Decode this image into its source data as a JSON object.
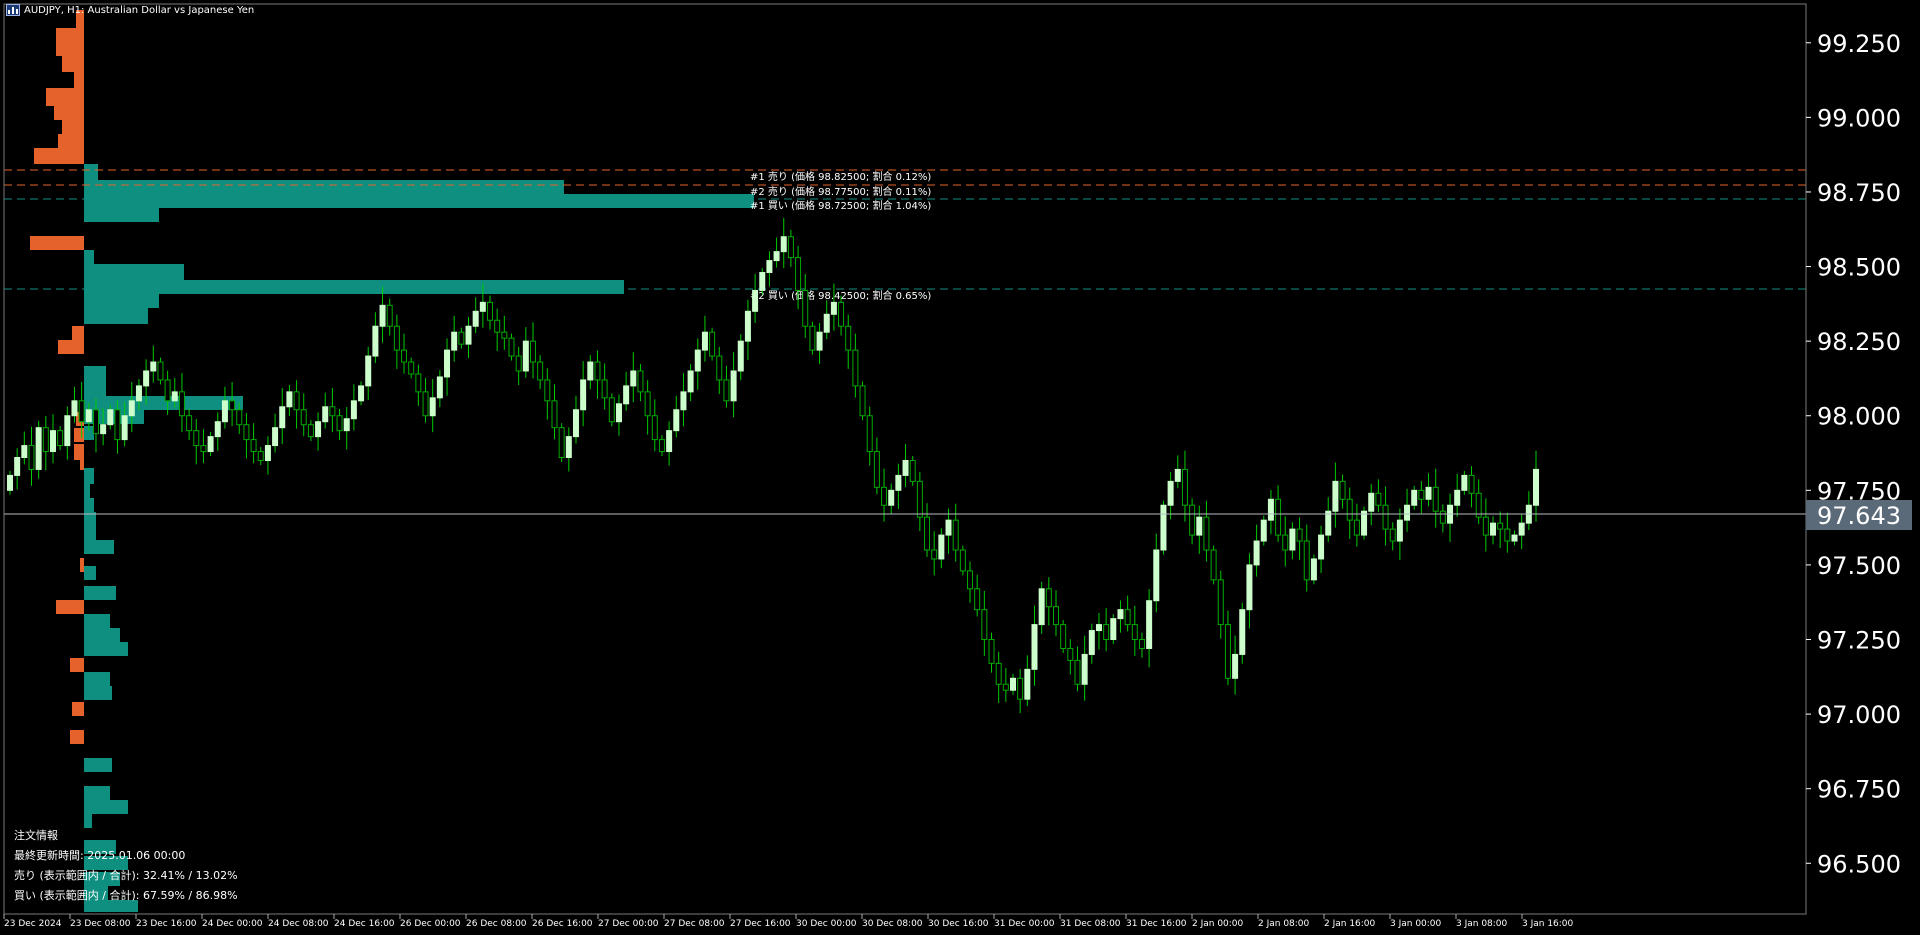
{
  "header": {
    "symbol_title": "AUDJPY, H1:  Australian Dollar vs Japanese Yen",
    "icon": "chart-window-icon"
  },
  "price_axis": {
    "labels": [
      "99.250",
      "99.000",
      "98.750",
      "98.500",
      "98.250",
      "98.000",
      "97.750",
      "97.500",
      "97.250",
      "97.000",
      "96.750",
      "96.500"
    ],
    "current_price": "97.643"
  },
  "time_axis": {
    "labels": [
      "23 Dec 2024",
      "23 Dec 08:00",
      "23 Dec 16:00",
      "24 Dec 00:00",
      "24 Dec 08:00",
      "24 Dec 16:00",
      "26 Dec 00:00",
      "26 Dec 08:00",
      "26 Dec 16:00",
      "27 Dec 00:00",
      "27 Dec 08:00",
      "27 Dec 16:00",
      "30 Dec 00:00",
      "30 Dec 08:00",
      "30 Dec 16:00",
      "31 Dec 00:00",
      "31 Dec 08:00",
      "31 Dec 16:00",
      "2 Jan 00:00",
      "2 Jan 08:00",
      "2 Jan 16:00",
      "3 Jan 00:00",
      "3 Jan 08:00",
      "3 Jan 16:00"
    ]
  },
  "level_labels": [
    {
      "text": "#1 売り (価格 98.82500; 割合 0.12%)",
      "price": 98.825,
      "side": "sell"
    },
    {
      "text": "#2 売り (価格 98.77500; 割合 0.11%)",
      "price": 98.775,
      "side": "sell"
    },
    {
      "text": "#1 買い (価格 98.72500; 割合 1.04%)",
      "price": 98.725,
      "side": "buy"
    },
    {
      "text": "#2 買い (価格 98.42500; 割合 0.65%)",
      "price": 98.425,
      "side": "buy"
    }
  ],
  "order_info": {
    "title": "注文情報",
    "last_update": "最終更新時間: 2025.01.06 00:00",
    "sell_ratio": "売り (表示範囲内 / 合計): 32.41% / 13.02%",
    "buy_ratio": "買い (表示範囲内 / 合計): 67.59% / 86.98%"
  },
  "colors": {
    "background": "#000000",
    "bull_candle": "#ccffcc",
    "bear_candle": "#00aa00",
    "wick": "#00cc00",
    "sell_bar": "#e5632b",
    "buy_bar": "#0f8f80",
    "current_price_badge": "#5b6a78",
    "axis_text": "#ffffff"
  },
  "chart_data": {
    "type": "candlestick",
    "symbol": "AUDJPY",
    "timeframe": "H1",
    "ylim": [
      96.33,
      99.38
    ],
    "current_price": 97.643,
    "closes": [
      97.8,
      97.86,
      97.9,
      97.82,
      97.96,
      97.88,
      97.95,
      97.9,
      98.0,
      98.05,
      97.98,
      98.02,
      97.94,
      97.97,
      98.02,
      97.92,
      98.0,
      98.05,
      98.1,
      98.15,
      98.18,
      98.12,
      98.05,
      98.08,
      98.0,
      97.95,
      97.9,
      97.88,
      97.93,
      97.98,
      98.05,
      98.02,
      97.97,
      97.92,
      97.88,
      97.85,
      97.9,
      97.96,
      98.03,
      98.08,
      98.02,
      97.97,
      97.93,
      97.98,
      98.03,
      98.0,
      97.95,
      97.99,
      98.05,
      98.1,
      98.2,
      98.3,
      98.37,
      98.3,
      98.22,
      98.18,
      98.14,
      98.08,
      98.0,
      98.06,
      98.13,
      98.22,
      98.28,
      98.24,
      98.3,
      98.35,
      98.38,
      98.32,
      98.28,
      98.26,
      98.2,
      98.15,
      98.25,
      98.18,
      98.12,
      98.05,
      97.96,
      97.86,
      97.93,
      98.02,
      98.12,
      98.18,
      98.12,
      98.06,
      97.98,
      98.04,
      98.1,
      98.15,
      98.08,
      98.0,
      97.92,
      97.88,
      97.95,
      98.02,
      98.08,
      98.15,
      98.22,
      98.28,
      98.2,
      98.12,
      98.05,
      98.15,
      98.25,
      98.35,
      98.42,
      98.48,
      98.52,
      98.55,
      98.6,
      98.53,
      98.42,
      98.3,
      98.22,
      98.28,
      98.34,
      98.38,
      98.3,
      98.22,
      98.1,
      98.0,
      97.88,
      97.76,
      97.7,
      97.75,
      97.8,
      97.85,
      97.78,
      97.66,
      97.55,
      97.52,
      97.6,
      97.65,
      97.55,
      97.48,
      97.42,
      97.35,
      97.25,
      97.17,
      97.1,
      97.08,
      97.12,
      97.05,
      97.15,
      97.3,
      97.42,
      97.36,
      97.3,
      97.22,
      97.18,
      97.1,
      97.2,
      97.28,
      97.3,
      97.25,
      97.32,
      97.35,
      97.3,
      97.25,
      97.22,
      97.38,
      97.55,
      97.7,
      97.78,
      97.82,
      97.7,
      97.6,
      97.66,
      97.55,
      97.45,
      97.3,
      97.12,
      97.2,
      97.35,
      97.5,
      97.58,
      97.65,
      97.72,
      97.6,
      97.55,
      97.62,
      97.58,
      97.45,
      97.52,
      97.6,
      97.68,
      97.78,
      97.72,
      97.65,
      97.6,
      97.68,
      97.74,
      97.7,
      97.62,
      97.58,
      97.65,
      97.7,
      97.75,
      97.72,
      97.76,
      97.68,
      97.64,
      97.7,
      97.75,
      97.8,
      97.74,
      97.66,
      97.6,
      97.64,
      97.62,
      97.58,
      97.6,
      97.64,
      97.7,
      97.82
    ]
  },
  "volume_profile": {
    "orange_bars": [
      {
        "y": 10,
        "h": 18,
        "w": 8
      },
      {
        "y": 28,
        "h": 28,
        "w": 28
      },
      {
        "y": 56,
        "h": 16,
        "w": 22
      },
      {
        "y": 72,
        "h": 16,
        "w": 10
      },
      {
        "y": 88,
        "h": 18,
        "w": 38
      },
      {
        "y": 106,
        "h": 14,
        "w": 30
      },
      {
        "y": 120,
        "h": 14,
        "w": 22
      },
      {
        "y": 134,
        "h": 14,
        "w": 26
      },
      {
        "y": 148,
        "h": 16,
        "w": 50
      },
      {
        "y": 236,
        "h": 14,
        "w": 54
      },
      {
        "y": 326,
        "h": 14,
        "w": 12
      },
      {
        "y": 340,
        "h": 14,
        "w": 26
      },
      {
        "y": 412,
        "h": 14,
        "w": 8
      },
      {
        "y": 428,
        "h": 14,
        "w": 10
      },
      {
        "y": 444,
        "h": 16,
        "w": 10
      },
      {
        "y": 460,
        "h": 10,
        "w": 4
      },
      {
        "y": 558,
        "h": 14,
        "w": 4
      },
      {
        "y": 600,
        "h": 14,
        "w": 28
      },
      {
        "y": 658,
        "h": 14,
        "w": 14
      },
      {
        "y": 702,
        "h": 14,
        "w": 12
      },
      {
        "y": 730,
        "h": 14,
        "w": 14
      }
    ],
    "teal_bars": [
      {
        "y": 164,
        "h": 16,
        "w": 14
      },
      {
        "y": 180,
        "h": 14,
        "w": 480
      },
      {
        "y": 194,
        "h": 14,
        "w": 670
      },
      {
        "y": 208,
        "h": 14,
        "w": 75
      },
      {
        "y": 250,
        "h": 14,
        "w": 10
      },
      {
        "y": 264,
        "h": 16,
        "w": 100
      },
      {
        "y": 280,
        "h": 14,
        "w": 540
      },
      {
        "y": 294,
        "h": 14,
        "w": 75
      },
      {
        "y": 308,
        "h": 16,
        "w": 64
      },
      {
        "y": 366,
        "h": 16,
        "w": 22
      },
      {
        "y": 382,
        "h": 14,
        "w": 22
      },
      {
        "y": 396,
        "h": 14,
        "w": 159
      },
      {
        "y": 410,
        "h": 14,
        "w": 60
      },
      {
        "y": 426,
        "h": 14,
        "w": 10
      },
      {
        "y": 468,
        "h": 16,
        "w": 10
      },
      {
        "y": 484,
        "h": 14,
        "w": 6
      },
      {
        "y": 498,
        "h": 14,
        "w": 10
      },
      {
        "y": 512,
        "h": 14,
        "w": 12
      },
      {
        "y": 526,
        "h": 14,
        "w": 12
      },
      {
        "y": 540,
        "h": 14,
        "w": 30
      },
      {
        "y": 566,
        "h": 14,
        "w": 12
      },
      {
        "y": 586,
        "h": 14,
        "w": 32
      },
      {
        "y": 614,
        "h": 14,
        "w": 26
      },
      {
        "y": 628,
        "h": 14,
        "w": 36
      },
      {
        "y": 642,
        "h": 14,
        "w": 44
      },
      {
        "y": 672,
        "h": 14,
        "w": 26
      },
      {
        "y": 686,
        "h": 14,
        "w": 28
      },
      {
        "y": 758,
        "h": 14,
        "w": 28
      },
      {
        "y": 786,
        "h": 14,
        "w": 26
      },
      {
        "y": 800,
        "h": 14,
        "w": 44
      },
      {
        "y": 814,
        "h": 14,
        "w": 8
      },
      {
        "y": 840,
        "h": 14,
        "w": 32
      },
      {
        "y": 856,
        "h": 14,
        "w": 44
      },
      {
        "y": 872,
        "h": 14,
        "w": 36
      },
      {
        "y": 886,
        "h": 14,
        "w": 24
      },
      {
        "y": 900,
        "h": 12,
        "w": 54
      }
    ]
  }
}
